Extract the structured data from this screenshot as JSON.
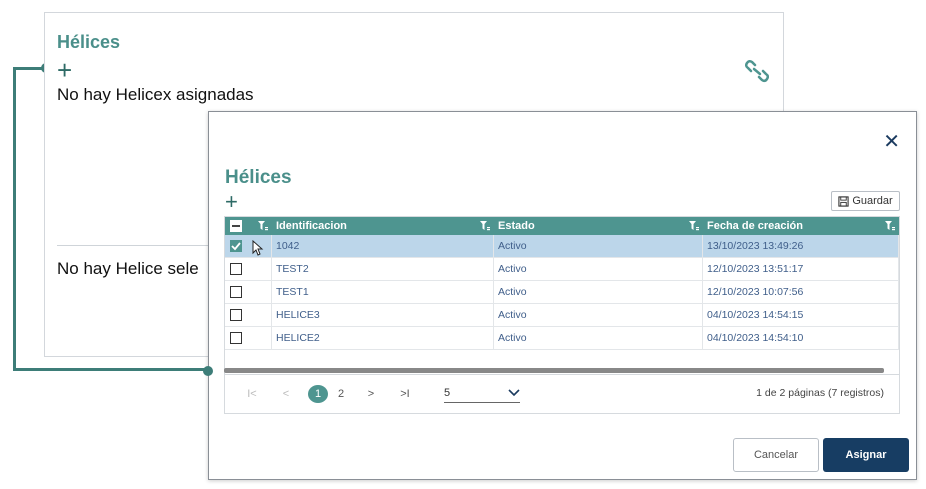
{
  "background": {
    "title": "Hélices",
    "add_label": "+",
    "empty_helices": "No hay Helicex asignadas",
    "empty_selected": "No hay Helice sele",
    "link_icon": "link-icon"
  },
  "modal": {
    "close_label": "✕",
    "title": "Hélices",
    "add_label": "+",
    "save_label": "Guardar",
    "columns": [
      "Identificacion",
      "Estado",
      "Fecha de creación"
    ],
    "rows": [
      {
        "id": "1042",
        "estado": "Activo",
        "fecha": "13/10/2023 13:49:26",
        "checked": true
      },
      {
        "id": "TEST2",
        "estado": "Activo",
        "fecha": "12/10/2023 13:51:17",
        "checked": false
      },
      {
        "id": "TEST1",
        "estado": "Activo",
        "fecha": "12/10/2023 10:07:56",
        "checked": false
      },
      {
        "id": "HELICE3",
        "estado": "Activo",
        "fecha": "04/10/2023 14:54:15",
        "checked": false
      },
      {
        "id": "HELICE2",
        "estado": "Activo",
        "fecha": "04/10/2023 14:54:10",
        "checked": false
      }
    ],
    "pager": {
      "first": "I<",
      "prev": "<",
      "pages": [
        "1",
        "2"
      ],
      "next": ">",
      "last": ">I",
      "page_size": "5",
      "info": "1 de 2 páginas (7 registros)"
    },
    "cancel_label": "Cancelar",
    "assign_label": "Asignar"
  },
  "colors": {
    "accent": "#4e9590",
    "primary": "#173d63",
    "selected_row": "#bcd6ea"
  }
}
